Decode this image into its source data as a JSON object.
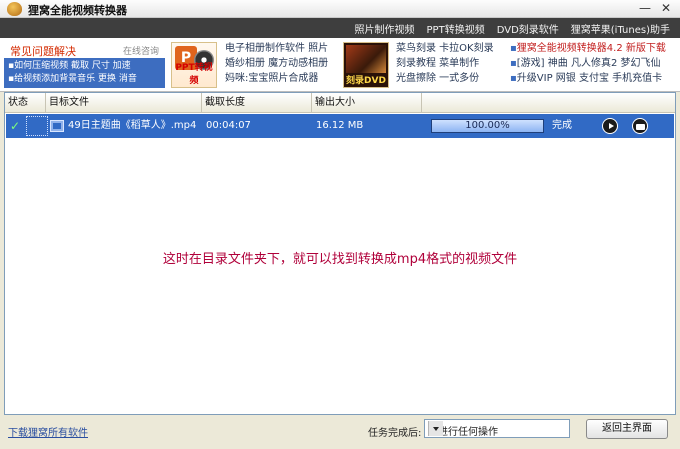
{
  "window": {
    "title": "狸窝全能视频转换器",
    "minimize_glyph": "—",
    "close_glyph": "✕"
  },
  "menubar": {
    "links": [
      "照片制作视频",
      "PPT转换视频",
      "DVD刻录软件",
      "狸窝苹果(iTunes)助手"
    ]
  },
  "ads": {
    "faq": {
      "title": "常见问题解决",
      "online": "在线咨询",
      "line1": "▪如何压缩视频 截取 尺寸 加速",
      "line2": "▪给视频添加背景音乐 更换 消音"
    },
    "ppt_badge": {
      "logo": "P",
      "caption": "PPT转视频"
    },
    "col1": [
      "电子相册制作软件 照片",
      "婚纱相册 魔方动感相册",
      "妈咪:宝宝照片合成器"
    ],
    "dvd_badge": {
      "caption": "刻录DVD"
    },
    "col2": [
      "菜鸟刻录 卡拉OK刻录",
      "刻录教程 菜单制作",
      "光盘擦除 一式多份"
    ],
    "col3": {
      "line1_dot": "▪",
      "line1": "狸窝全能视频转换器4.2 新版下载",
      "line2_dot": "▪",
      "line2": "[游戏] 神曲 凡人修真2 梦幻飞仙",
      "line3_dot": "▪",
      "line3": "升级VIP 网银 支付宝 手机充值卡"
    }
  },
  "table": {
    "headers": {
      "status": "状态",
      "target": "目标文件",
      "duration": "截取长度",
      "size": "输出大小"
    },
    "rows": [
      {
        "check": "✓",
        "file": "49日主题曲《稻草人》.mp4",
        "duration": "00:04:07",
        "size": "16.12 MB",
        "progress_text": "100.00%",
        "progress_value": 100,
        "state": "完成"
      }
    ],
    "note": "这时在目录文件夹下，就可以找到转换成mp4格式的视频文件"
  },
  "footer": {
    "download_link": "下载狸窝所有软件",
    "after_label": "任务完成后:",
    "after_value": "不进行任何操作",
    "back_button": "返回主界面"
  },
  "colors": {
    "selection": "#316ac5",
    "menubar": "#3e3e3e",
    "note": "#b0003a"
  }
}
